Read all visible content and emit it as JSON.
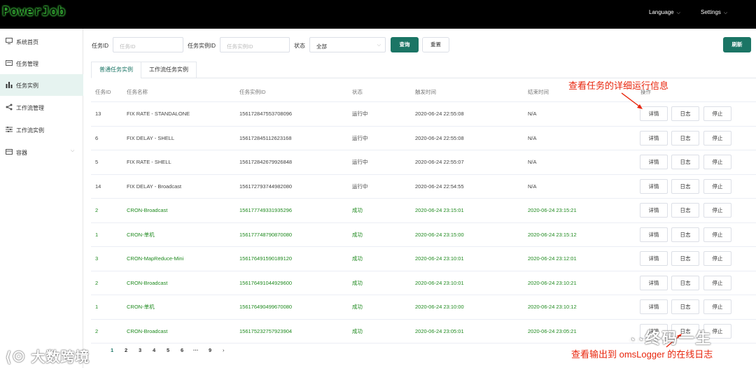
{
  "header": {
    "logo": "PowerJob",
    "language_label": "Language",
    "settings_label": "Settings"
  },
  "sidebar": {
    "items": [
      {
        "label": "系统首页",
        "icon": "monitor-icon"
      },
      {
        "label": "任务管理",
        "icon": "task-icon"
      },
      {
        "label": "任务实例",
        "icon": "bar-chart-icon",
        "active": true
      },
      {
        "label": "工作流管理",
        "icon": "share-icon"
      },
      {
        "label": "工作流实例",
        "icon": "sliders-icon"
      },
      {
        "label": "容器",
        "icon": "container-icon",
        "has_submenu": true
      }
    ]
  },
  "filters": {
    "task_id_label": "任务ID",
    "task_id_placeholder": "任务ID",
    "instance_id_label": "任务实例ID",
    "instance_id_placeholder": "任务实例ID",
    "status_label": "状态",
    "status_value": "全部",
    "query_button": "查询",
    "reset_button": "重置",
    "refresh_button": "刷新"
  },
  "tabs": [
    {
      "label": "普通任务实例",
      "active": true
    },
    {
      "label": "工作流任务实例",
      "active": false
    }
  ],
  "table": {
    "columns": [
      "任务ID",
      "任务名称",
      "任务实例ID",
      "状态",
      "触发时间",
      "结束时间",
      "操作"
    ],
    "action_labels": {
      "detail": "详情",
      "log": "日志",
      "stop": "停止"
    },
    "rows": [
      {
        "id": "13",
        "name": "FIX RATE - STANDALONE",
        "instance": "156172847553708096",
        "status": "运行中",
        "trigger": "2020-06-24 22:55:08",
        "end": "N/A",
        "kind": "running"
      },
      {
        "id": "6",
        "name": "FIX DELAY - SHELL",
        "instance": "156172845112623168",
        "status": "运行中",
        "trigger": "2020-06-24 22:55:08",
        "end": "N/A",
        "kind": "running"
      },
      {
        "id": "5",
        "name": "FIX RATE - SHELL",
        "instance": "156172842679926848",
        "status": "运行中",
        "trigger": "2020-06-24 22:55:07",
        "end": "N/A",
        "kind": "running"
      },
      {
        "id": "14",
        "name": "FIX DELAY - Broadcast",
        "instance": "156172793744982080",
        "status": "运行中",
        "trigger": "2020-06-24 22:54:55",
        "end": "N/A",
        "kind": "running"
      },
      {
        "id": "2",
        "name": "CRON-Broadcast",
        "instance": "156177749331935296",
        "status": "成功",
        "trigger": "2020-06-24 23:15:01",
        "end": "2020-06-24 23:15:21",
        "kind": "success"
      },
      {
        "id": "1",
        "name": "CRON-单机",
        "instance": "156177748790870080",
        "status": "成功",
        "trigger": "2020-06-24 23:15:00",
        "end": "2020-06-24 23:15:12",
        "kind": "success"
      },
      {
        "id": "3",
        "name": "CRON-MapReduce-Mini",
        "instance": "156176491590189120",
        "status": "成功",
        "trigger": "2020-06-24 23:10:01",
        "end": "2020-06-24 23:12:01",
        "kind": "success"
      },
      {
        "id": "2",
        "name": "CRON-Broadcast",
        "instance": "156176491044929600",
        "status": "成功",
        "trigger": "2020-06-24 23:10:01",
        "end": "2020-06-24 23:10:21",
        "kind": "success"
      },
      {
        "id": "1",
        "name": "CRON-单机",
        "instance": "156176490499670080",
        "status": "成功",
        "trigger": "2020-06-24 23:10:00",
        "end": "2020-06-24 23:10:12",
        "kind": "success"
      },
      {
        "id": "2",
        "name": "CRON-Broadcast",
        "instance": "156175232757923904",
        "status": "成功",
        "trigger": "2020-06-24 23:05:01",
        "end": "2020-06-24 23:05:21",
        "kind": "success"
      }
    ]
  },
  "pagination": {
    "pages": [
      "1",
      "2",
      "3",
      "4",
      "5",
      "6",
      "···",
      "9"
    ],
    "current": "1",
    "next_icon": "chevron-right-icon"
  },
  "annotations": {
    "detail_note": "查看任务的详细运行信息",
    "log_note": "查看输出到 omsLogger 的在线日志"
  },
  "watermarks": {
    "bottom_left": "大数跨境",
    "bottom_right": "终码一生"
  },
  "colors": {
    "primary": "#1b7565",
    "success_text": "#1f8a1f",
    "annotation": "#e8250c",
    "header_bg": "#000000"
  }
}
